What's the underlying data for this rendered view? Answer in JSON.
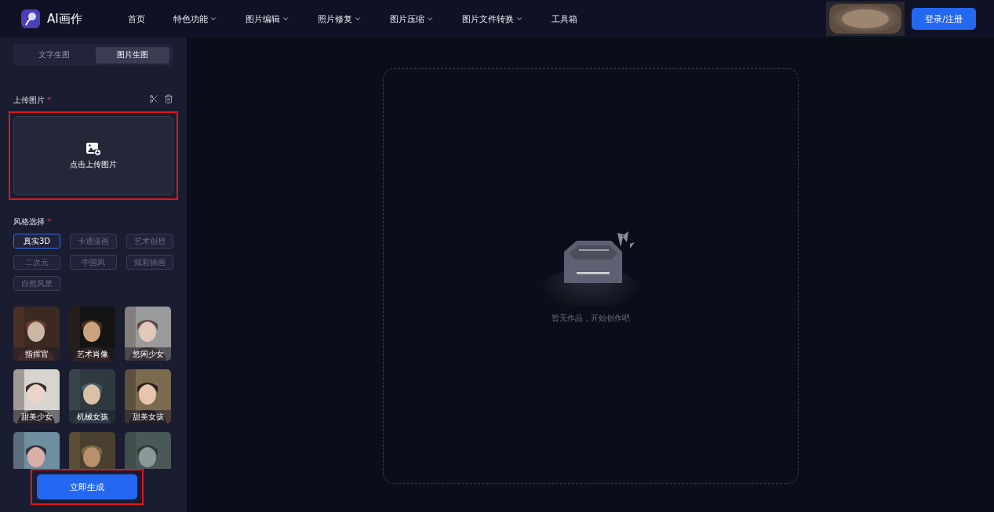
{
  "header": {
    "logo_text": "AI画作",
    "nav": [
      {
        "label": "首页",
        "dropdown": false
      },
      {
        "label": "特色功能",
        "dropdown": true
      },
      {
        "label": "图片编辑",
        "dropdown": true
      },
      {
        "label": "照片修复",
        "dropdown": true
      },
      {
        "label": "图片压缩",
        "dropdown": true
      },
      {
        "label": "图片文件转换",
        "dropdown": true
      },
      {
        "label": "工具箱",
        "dropdown": false
      }
    ],
    "login_button": "登录/注册"
  },
  "sidebar": {
    "mode_tabs": [
      {
        "label": "文字生图",
        "selected": false
      },
      {
        "label": "图片生图",
        "selected": true
      }
    ],
    "upload": {
      "label": "上传图片",
      "required_mark": "*",
      "hint": "点击上传图片",
      "highlighted": true
    },
    "style": {
      "label": "风格选择",
      "required_mark": "*",
      "options": [
        {
          "label": "真实3D",
          "selected": true
        },
        {
          "label": "卡通漫画",
          "selected": false
        },
        {
          "label": "艺术创想",
          "selected": false
        },
        {
          "label": "二次元",
          "selected": false
        },
        {
          "label": "中国风",
          "selected": false
        },
        {
          "label": "炫彩插画",
          "selected": false
        },
        {
          "label": "自然风景",
          "selected": false
        }
      ]
    },
    "presets": [
      {
        "kind": "labeled",
        "label": "指挥官"
      },
      {
        "kind": "labeled",
        "label": "艺术肖像"
      },
      {
        "kind": "labeled",
        "label": "悠闲少女"
      },
      {
        "kind": "labeled",
        "label": "甜美少女"
      },
      {
        "kind": "labeled",
        "label": "机械女孩"
      },
      {
        "kind": "labeled",
        "label": "甜美女孩"
      },
      {
        "kind": "plain"
      },
      {
        "kind": "plain"
      },
      {
        "kind": "plain"
      }
    ],
    "generate_button": {
      "label": "立即生成",
      "highlighted": true
    }
  },
  "canvas": {
    "empty_text": "暂无作品，开始创作吧"
  }
}
